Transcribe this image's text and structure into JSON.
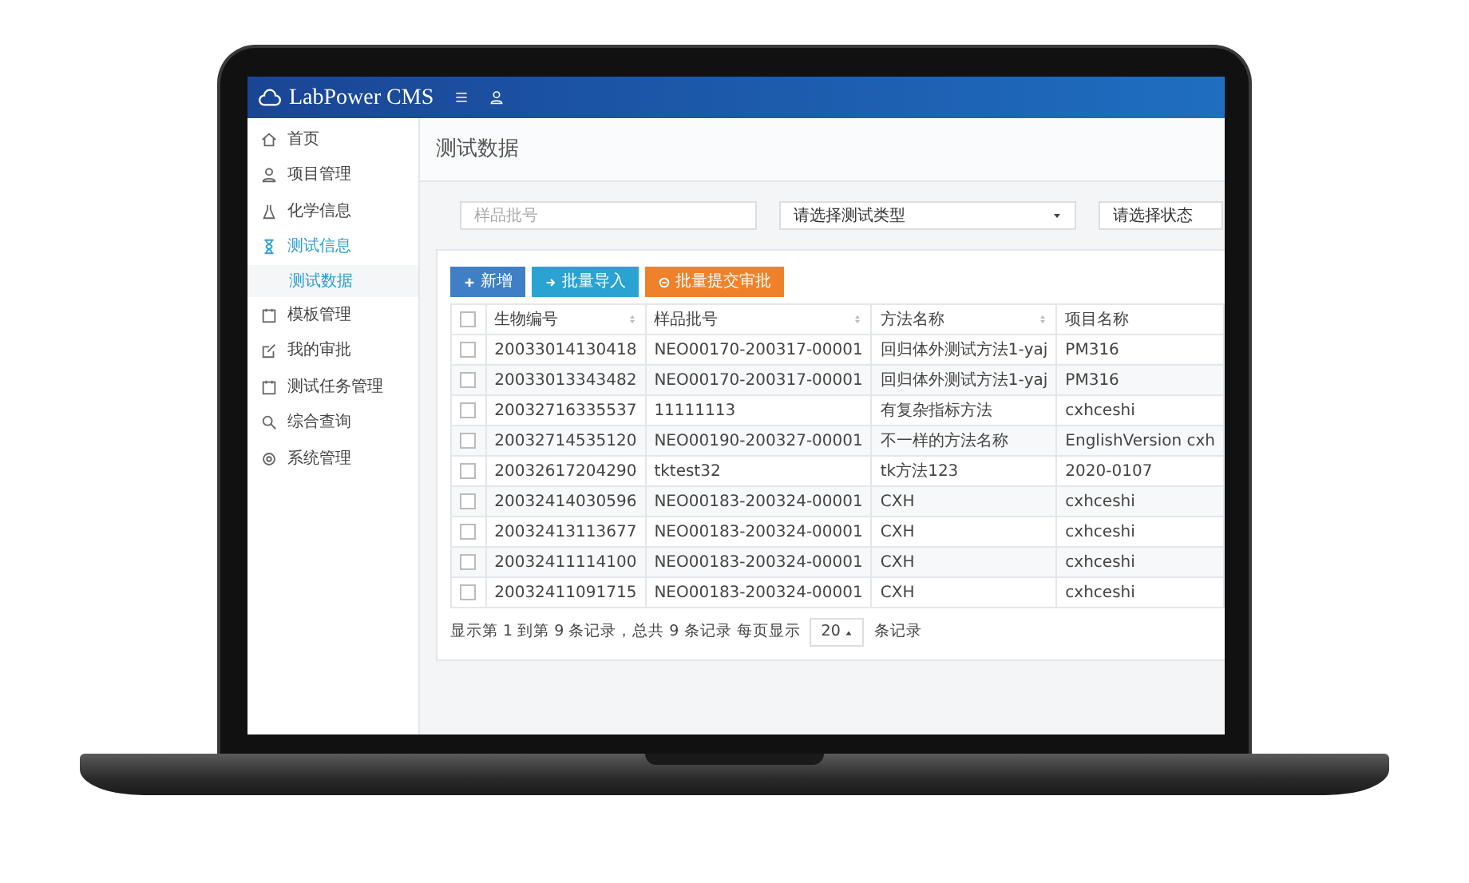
{
  "navbar": {
    "brand": "LabPower CMS"
  },
  "sidebar": {
    "items": [
      {
        "label": "首页",
        "selected": false
      },
      {
        "label": "项目管理",
        "selected": false
      },
      {
        "label": "化学信息",
        "selected": false
      },
      {
        "label": "测试信息",
        "selected": true,
        "children": [
          {
            "label": "测试数据",
            "selected": true
          }
        ]
      },
      {
        "label": "模板管理",
        "selected": false
      },
      {
        "label": "我的审批",
        "selected": false
      },
      {
        "label": "测试任务管理",
        "selected": false
      },
      {
        "label": "综合查询",
        "selected": false
      },
      {
        "label": "系统管理",
        "selected": false
      }
    ]
  },
  "page_title": "测试数据",
  "filters": [
    {
      "kind": "input",
      "placeholder": "样品批号"
    },
    {
      "kind": "select",
      "value": "请选择测试类型",
      "caret": true
    },
    {
      "kind": "select",
      "value": "请选择状态",
      "caret": false
    }
  ],
  "toolbar": [
    {
      "label": "新增",
      "kind": "primary"
    },
    {
      "label": "批量导入",
      "kind": "info"
    },
    {
      "label": "批量提交审批",
      "kind": "warning"
    }
  ],
  "table": {
    "header_checked": false,
    "columns": [
      {
        "label": "生物编号",
        "sortable": true
      },
      {
        "label": "样品批号",
        "sortable": true
      },
      {
        "label": "方法名称",
        "sortable": true
      },
      {
        "label": "项目名称",
        "sortable": false
      }
    ],
    "rows": [
      {
        "checked": false,
        "cells": [
          "20033014130418",
          "NEO00170-200317-00001",
          "回归体外测试方法1-yaj",
          "PM316"
        ]
      },
      {
        "checked": false,
        "cells": [
          "20033013343482",
          "NEO00170-200317-00001",
          "回归体外测试方法1-yaj",
          "PM316"
        ]
      },
      {
        "checked": false,
        "cells": [
          "20032716335537",
          "11111113",
          "有复杂指标方法",
          "cxhceshi"
        ]
      },
      {
        "checked": false,
        "cells": [
          "20032714535120",
          "NEO00190-200327-00001",
          "不一样的方法名称",
          "EnglishVersion cxh"
        ]
      },
      {
        "checked": false,
        "cells": [
          "20032617204290",
          "tktest32",
          "tk方法123",
          "2020-0107"
        ]
      },
      {
        "checked": false,
        "cells": [
          "20032414030596",
          "NEO00183-200324-00001",
          "CXH",
          "cxhceshi"
        ]
      },
      {
        "checked": false,
        "cells": [
          "20032413113677",
          "NEO00183-200324-00001",
          "CXH",
          "cxhceshi"
        ]
      },
      {
        "checked": false,
        "cells": [
          "20032411114100",
          "NEO00183-200324-00001",
          "CXH",
          "cxhceshi"
        ]
      },
      {
        "checked": false,
        "cells": [
          "20032411091715",
          "NEO00183-200324-00001",
          "CXH",
          "cxhceshi"
        ]
      }
    ]
  },
  "pagination": {
    "summary": "显示第 1 到第 9 条记录，总共 9 条记录 每页显示",
    "page_size": "20",
    "suffix": "条记录"
  }
}
